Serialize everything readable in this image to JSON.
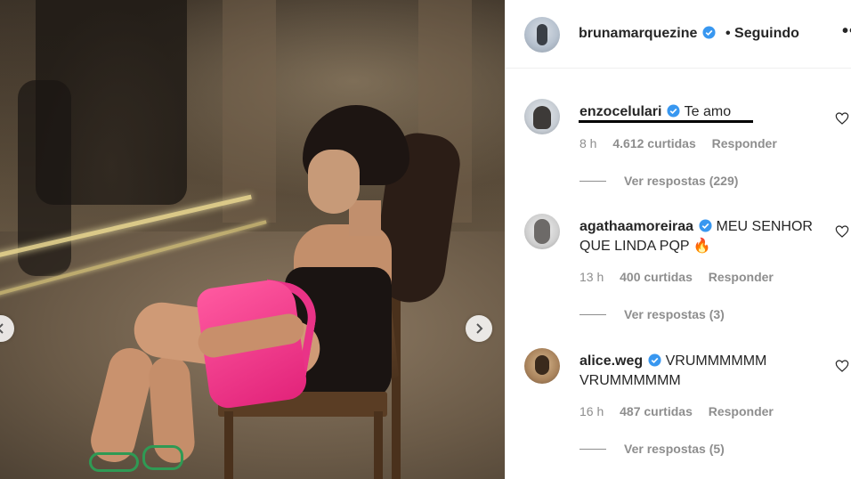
{
  "header": {
    "username": "brunamarquezine",
    "follow_status": "• Seguindo",
    "more": "•••"
  },
  "comments": [
    {
      "username": "enzocelulari",
      "text": "Te amo",
      "time": "8 h",
      "likes": "4.612 curtidas",
      "reply": "Responder",
      "replies": "Ver respostas (229)"
    },
    {
      "username": "agathaamoreiraa",
      "text": "MEU SENHOR QUE LINDA PQP 🔥",
      "time": "13 h",
      "likes": "400 curtidas",
      "reply": "Responder",
      "replies": "Ver respostas (3)"
    },
    {
      "username": "alice.weg",
      "text": "VRUMMMMMM VRUMMMMMM",
      "time": "16 h",
      "likes": "487 curtidas",
      "reply": "Responder",
      "replies": "Ver respostas (5)"
    }
  ],
  "icons": {
    "verified": "verified-badge-icon",
    "heart": "heart-icon",
    "prev": "chevron-left-icon",
    "next": "chevron-right-icon"
  },
  "colors": {
    "verified_blue": "#3897f0",
    "muted_text": "#8e8e8e",
    "primary_text": "#262626"
  }
}
